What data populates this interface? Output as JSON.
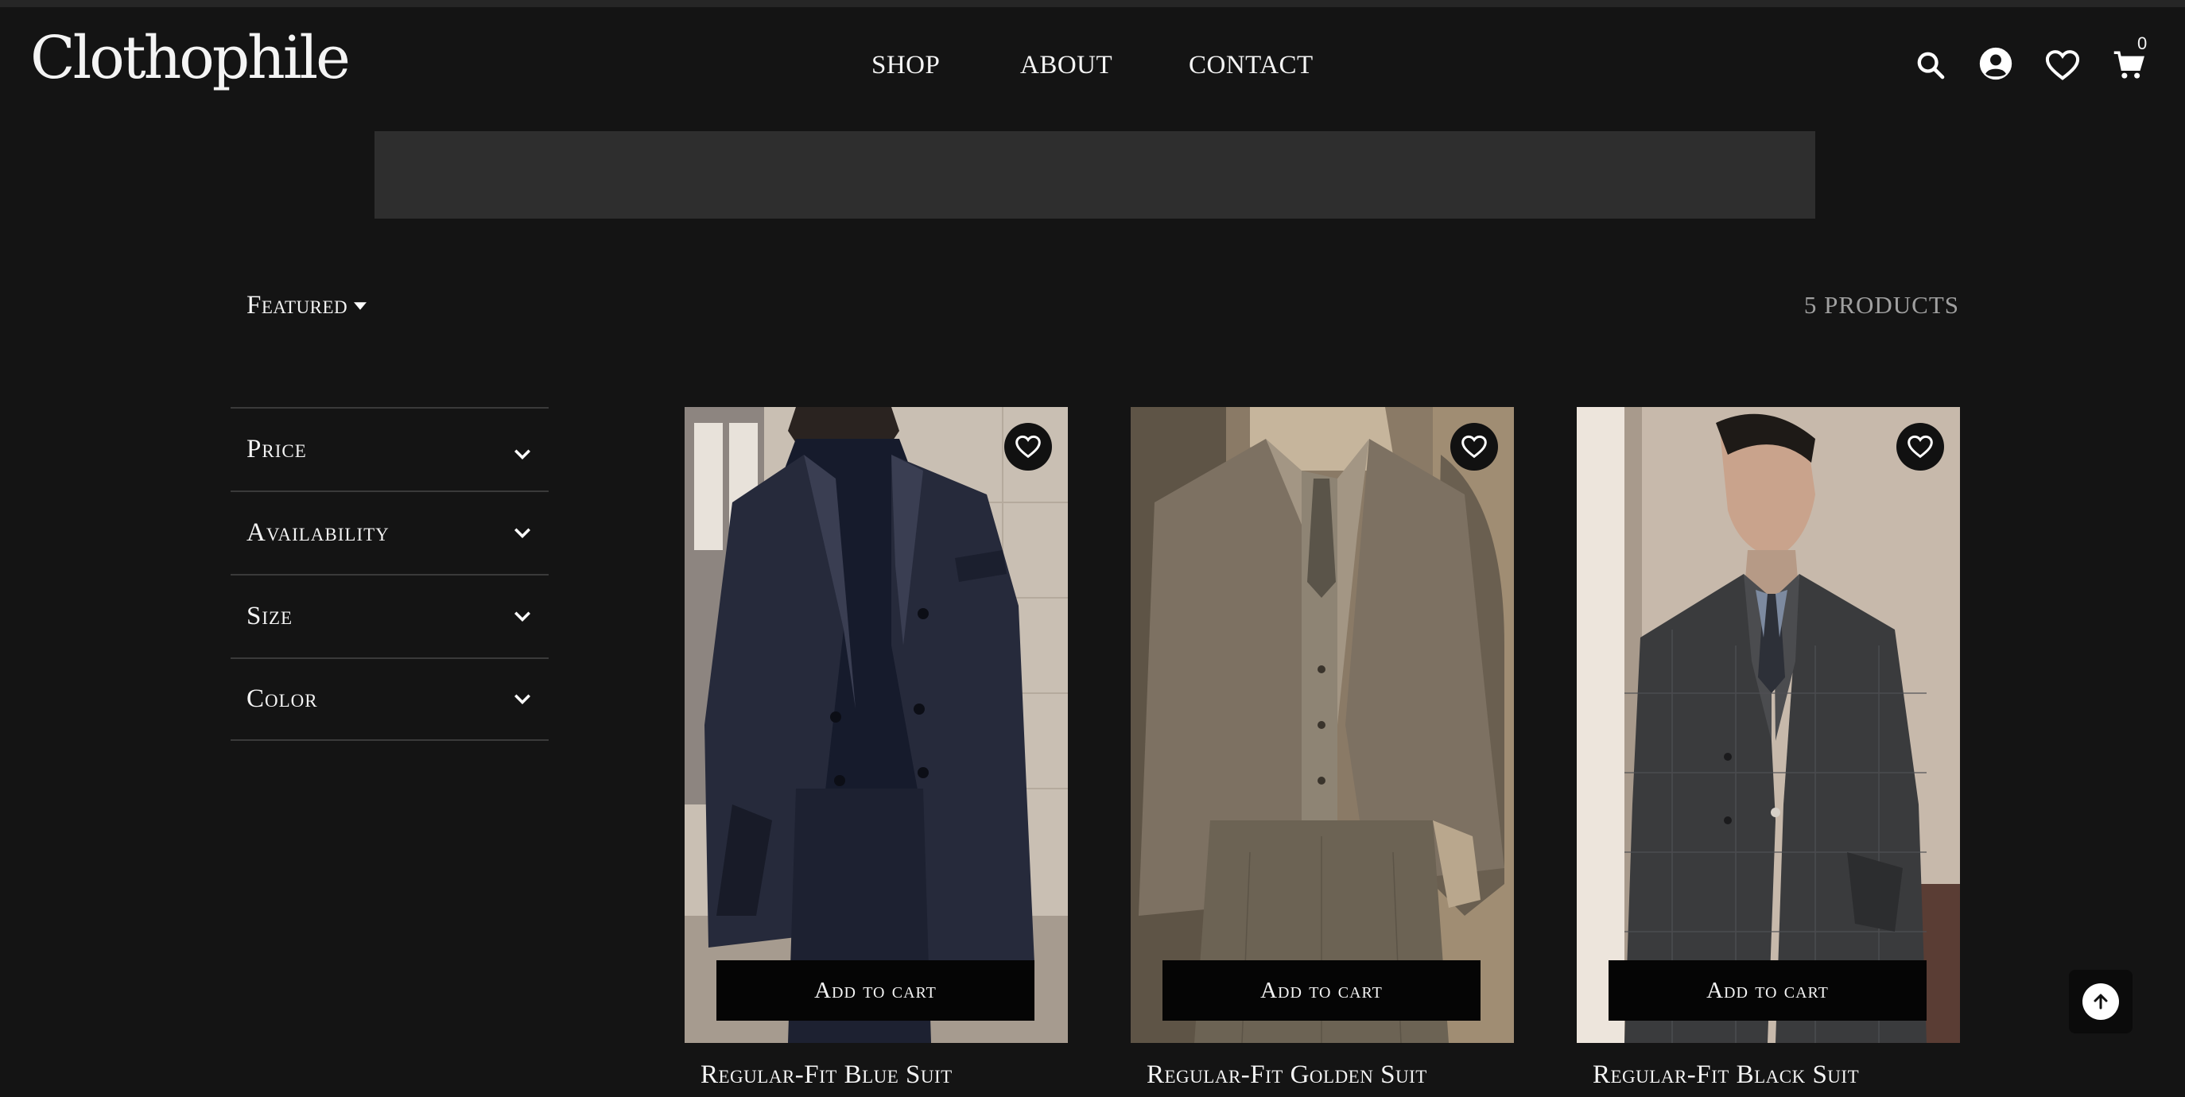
{
  "brand": {
    "logo_text": "Clothophile"
  },
  "nav": {
    "items": [
      "SHOP",
      "ABOUT",
      "CONTACT"
    ]
  },
  "header_icons": [
    "search-icon",
    "account-icon",
    "heart-icon",
    "cart-icon"
  ],
  "cart": {
    "count": "0"
  },
  "toolbar": {
    "sort_label": "Featured",
    "product_count": "5 PRODUCTS"
  },
  "filters": [
    "Price",
    "Availability",
    "Size",
    "Color"
  ],
  "products": [
    {
      "name": "Regular-Fit Blue Suit",
      "cta": "Add to cart"
    },
    {
      "name": "Regular-Fit Golden Suit",
      "cta": "Add to cart"
    },
    {
      "name": "Regular-Fit Black Suit",
      "cta": "Add to cart"
    }
  ],
  "colors": {
    "background": "#141414",
    "banner": "#2e2e2e",
    "button": "#050505",
    "text": "#f4f4f4"
  }
}
